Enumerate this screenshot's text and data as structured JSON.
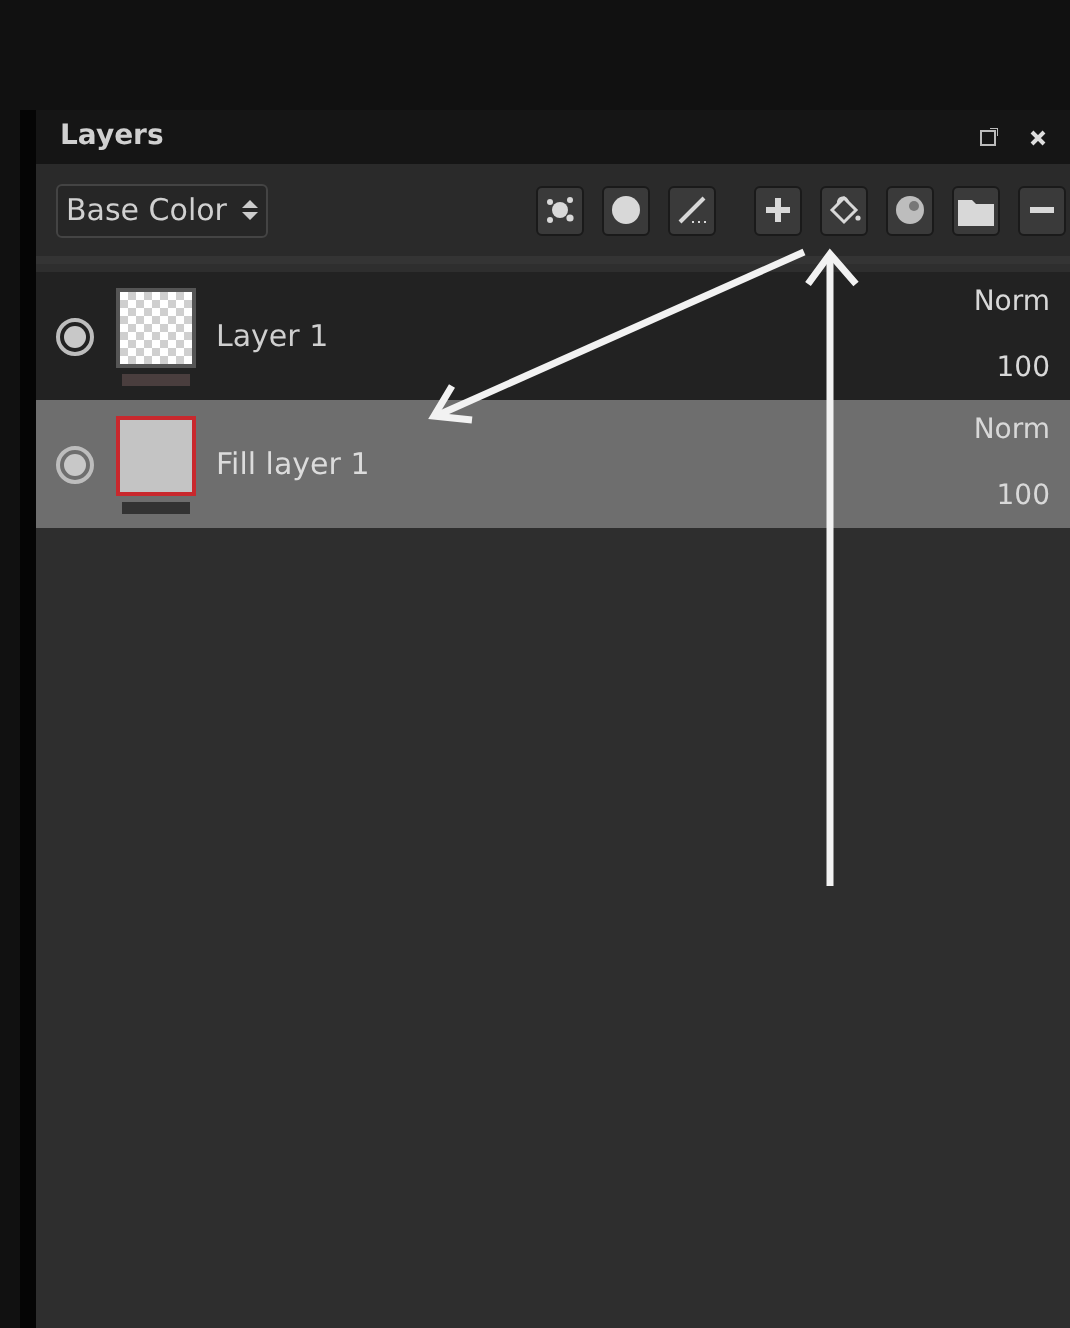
{
  "panel": {
    "title": "Layers"
  },
  "channel_select": {
    "value": "Base Color"
  },
  "toolbar": [
    {
      "kind": "mask"
    },
    {
      "kind": "circle"
    },
    {
      "kind": "brush"
    },
    {
      "kind": "add"
    },
    {
      "kind": "fill"
    },
    {
      "kind": "ball"
    },
    {
      "kind": "folder"
    },
    {
      "kind": "remove"
    }
  ],
  "layers": [
    {
      "name": "Layer 1",
      "kind": "paint",
      "visible": true,
      "selected": false,
      "blend": "Norm",
      "opacity": "100"
    },
    {
      "name": "Fill layer 1",
      "kind": "fill",
      "visible": true,
      "selected": true,
      "blend": "Norm",
      "opacity": "100"
    }
  ]
}
